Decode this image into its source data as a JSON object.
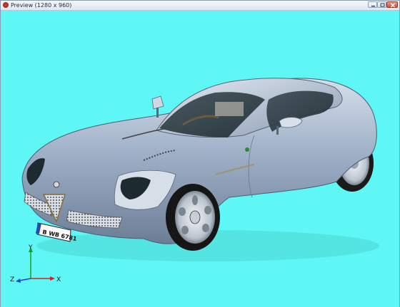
{
  "window": {
    "title": "Preview (1280 x 960)"
  },
  "scene": {
    "background_color": "#5ef7f5",
    "car_body_color": "#9eafc7",
    "license_plate": "B WB 6781"
  },
  "axis_gizmo": {
    "x_label": "X",
    "y_label": "Y",
    "z_label": "Z"
  },
  "icons": {
    "app": "app-icon",
    "minimize": "minimize-icon",
    "maximize": "maximize-icon",
    "close": "close-icon"
  }
}
